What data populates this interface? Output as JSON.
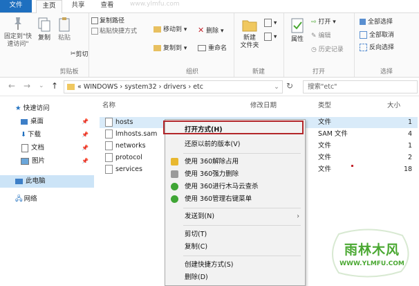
{
  "ribbon_tabs": [
    "文件",
    "主页",
    "共享",
    "查看"
  ],
  "watermark_top": "www.ylmfu.com",
  "clipboard": {
    "pin_label": "固定到\"快\n速访问\"",
    "copy_label": "复制",
    "paste_label": "粘贴",
    "copy_path": "复制路径",
    "paste_shortcut": "粘贴快捷方式",
    "cut": "剪切",
    "group_label": "剪贴板"
  },
  "organize": {
    "move_to": "移动到",
    "delete": "删除",
    "copy_to": "复制到",
    "rename": "重命名",
    "group_label": "组织"
  },
  "new_group": {
    "new_folder": "新建\n文件夹",
    "group_label": "新建"
  },
  "open_group": {
    "properties": "属性",
    "open": "打开",
    "edit": "编辑",
    "history": "历史记录",
    "group_label": "打开"
  },
  "select_group": {
    "select_all": "全部选择",
    "select_none": "全部取消",
    "invert": "反向选择",
    "group_label": "选择"
  },
  "address": {
    "path": "« WINDOWS › system32 › drivers › etc",
    "search_placeholder": "搜索\"etc\""
  },
  "sidebar": {
    "quick_access": "快速访问",
    "items": [
      "桌面",
      "下载",
      "文档",
      "图片"
    ],
    "this_pc": "此电脑",
    "network": "网络"
  },
  "columns": {
    "name": "名称",
    "date": "修改日期",
    "type": "类型",
    "size": "大小"
  },
  "files": [
    {
      "name": "hosts",
      "type": "文件",
      "size": "1"
    },
    {
      "name": "lmhosts.sam",
      "type": "SAM 文件",
      "size": "4"
    },
    {
      "name": "networks",
      "type": "文件",
      "size": "1"
    },
    {
      "name": "protocol",
      "type": "文件",
      "size": "2"
    },
    {
      "name": "services",
      "type": "文件",
      "size": "18"
    }
  ],
  "context_menu": {
    "open_with": "打开方式(H)",
    "restore": "还原以前的版本(V)",
    "unlock360": "使用 360解除占用",
    "forcedel360": "使用 360强力删除",
    "trojan360": "使用 360进行木马云查杀",
    "manage360": "使用 360管理右键菜单",
    "send_to": "发送到(N)",
    "cut": "剪切(T)",
    "copy": "复制(C)",
    "shortcut": "创建快捷方式(S)",
    "delete": "删除(D)"
  },
  "logo": {
    "main": "雨林木风",
    "url": "WWW.YLMFU.COM"
  },
  "colors": {
    "accent": "#1e6fbf",
    "selection": "#cce4f7",
    "highlight_border": "#b3262a",
    "logo_green": "#4aa832"
  }
}
